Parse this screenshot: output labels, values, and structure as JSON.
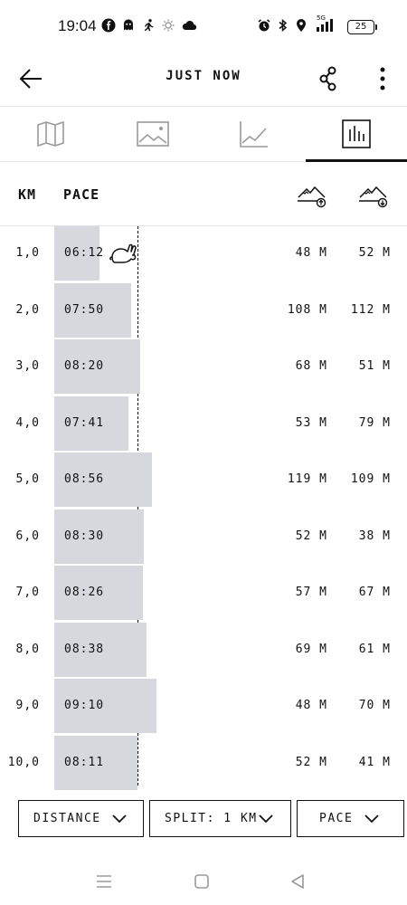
{
  "status_bar": {
    "time": "19:04",
    "left_icons": [
      "facebook-icon",
      "ghost-icon",
      "runner-icon",
      "gear-icon",
      "cloud-icon"
    ],
    "right_icons": [
      "alarm-icon",
      "bluetooth-icon",
      "location-icon",
      "signal-5g-icon"
    ],
    "network": "5G",
    "battery": "25"
  },
  "top_bar": {
    "title": "JUST NOW",
    "back_icon": "arrow-left-icon",
    "share_icon": "share-icon",
    "more_icon": "more-vertical-icon"
  },
  "tabs": [
    {
      "name": "map",
      "icon": "map-icon",
      "active": false
    },
    {
      "name": "photos",
      "icon": "image-icon",
      "active": false
    },
    {
      "name": "graph",
      "icon": "line-chart-icon",
      "active": false
    },
    {
      "name": "splits",
      "icon": "bar-chart-icon",
      "active": true
    }
  ],
  "table_header": {
    "km": "KM",
    "pace": "PACE",
    "elev_up_icon": "elevation-gain-icon",
    "elev_down_icon": "elevation-loss-icon"
  },
  "splits": [
    {
      "km": "1,0",
      "pace": "06:12",
      "up": "48 M",
      "down": "52 M",
      "fastest": true
    },
    {
      "km": "2,0",
      "pace": "07:50",
      "up": "108 M",
      "down": "112 M",
      "fastest": false
    },
    {
      "km": "3,0",
      "pace": "08:20",
      "up": "68 M",
      "down": "51 M",
      "fastest": false
    },
    {
      "km": "4,0",
      "pace": "07:41",
      "up": "53 M",
      "down": "79 M",
      "fastest": false
    },
    {
      "km": "5,0",
      "pace": "08:56",
      "up": "119 M",
      "down": "109 M",
      "fastest": false
    },
    {
      "km": "6,0",
      "pace": "08:30",
      "up": "52 M",
      "down": "38 M",
      "fastest": false
    },
    {
      "km": "7,0",
      "pace": "08:26",
      "up": "57 M",
      "down": "67 M",
      "fastest": false
    },
    {
      "km": "8,0",
      "pace": "08:38",
      "up": "69 M",
      "down": "61 M",
      "fastest": false
    },
    {
      "km": "9,0",
      "pace": "09:10",
      "up": "48 M",
      "down": "70 M",
      "fastest": false
    },
    {
      "km": "10,0",
      "pace": "08:11",
      "up": "52 M",
      "down": "41 M",
      "fastest": false
    }
  ],
  "fastest_icon": "rabbit-icon",
  "colors": {
    "bar": "#d7d7de",
    "text": "#111111",
    "divider": "#e3e3e3"
  },
  "filters": {
    "distance": "DISTANCE",
    "split": "SPLIT: 1 KM",
    "pace": "PACE"
  },
  "nav_bar": {
    "icons": [
      "menu-icon",
      "home-square-icon",
      "back-triangle-icon"
    ]
  }
}
